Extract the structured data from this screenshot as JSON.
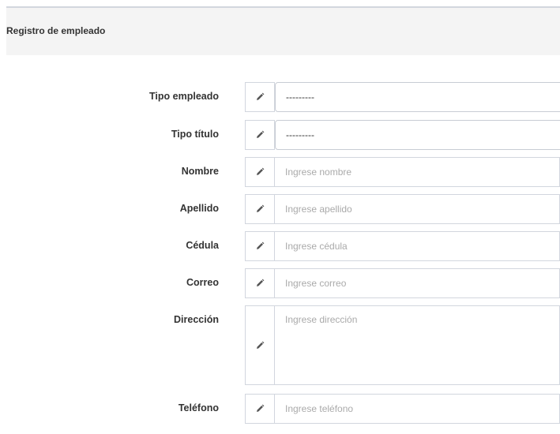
{
  "header": {
    "title": "Registro de empleado"
  },
  "form": {
    "rows": [
      {
        "label": "Tipo empleado",
        "type": "select",
        "value": "---------"
      },
      {
        "label": "Tipo título",
        "type": "select",
        "value": "---------"
      },
      {
        "label": "Nombre",
        "type": "input",
        "placeholder": "Ingrese nombre"
      },
      {
        "label": "Apellido",
        "type": "input",
        "placeholder": "Ingrese apellido"
      },
      {
        "label": "Cédula",
        "type": "input",
        "placeholder": "Ingrese cédula"
      },
      {
        "label": "Correo",
        "type": "input",
        "placeholder": "Ingrese correo"
      },
      {
        "label": "Dirección",
        "type": "textarea",
        "placeholder": "Ingrese dirección"
      },
      {
        "label": "Teléfono",
        "type": "input",
        "placeholder": "Ingrese teléfono"
      }
    ],
    "addon_icon": "pencil-icon"
  },
  "colors": {
    "header_bg": "#f4f4f4",
    "border": "#d2d6de",
    "label_text": "#333333",
    "placeholder_text": "#aaaaaa"
  }
}
